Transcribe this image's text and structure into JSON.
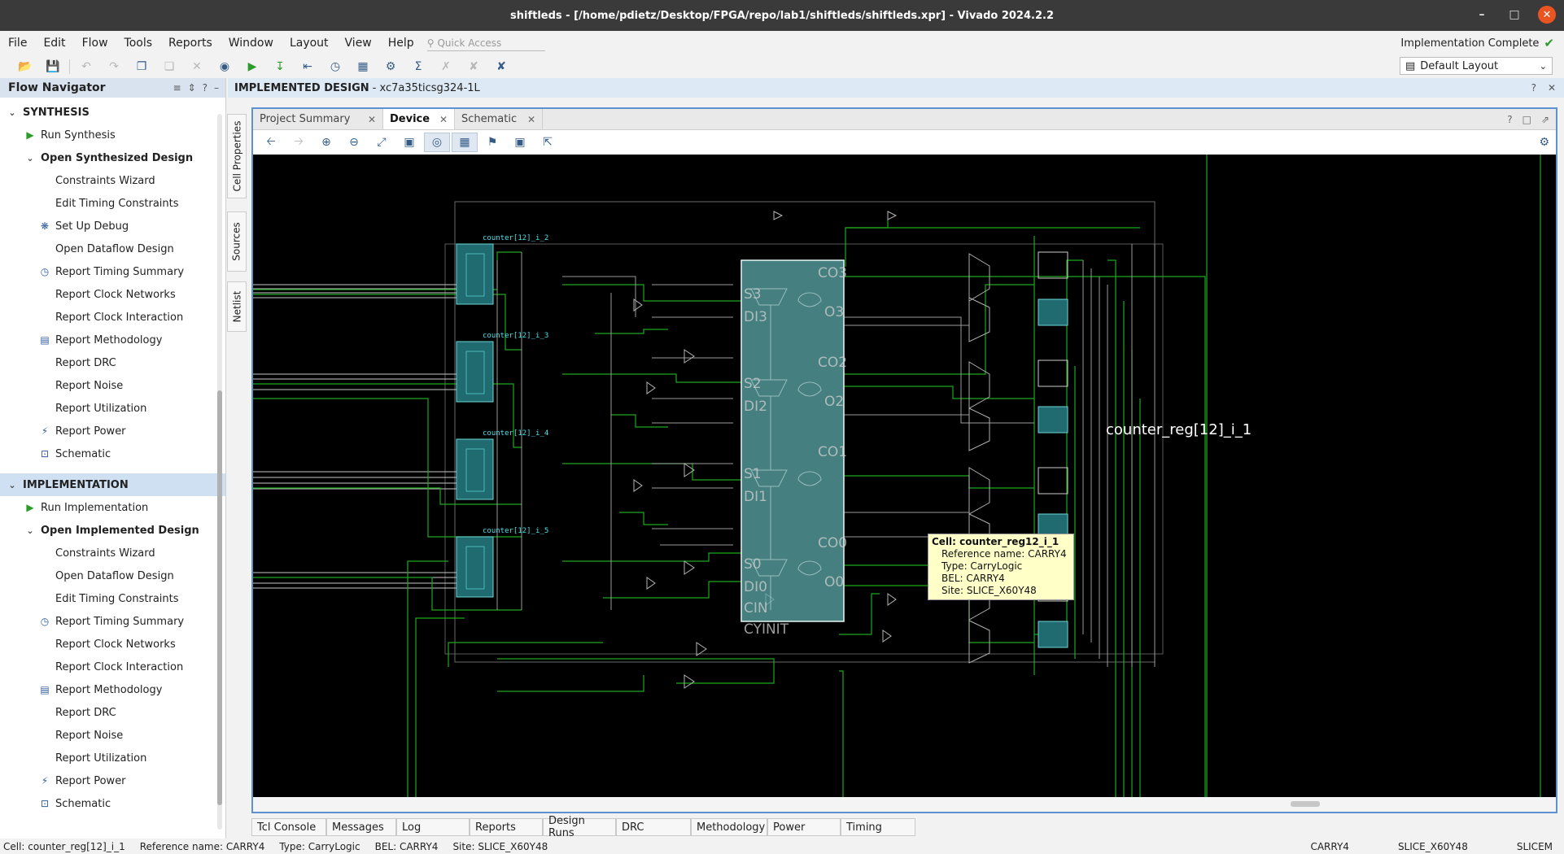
{
  "window": {
    "title": "shiftleds - [/home/pdietz/Desktop/FPGA/repo/lab1/shiftleds/shiftleds.xpr] - Vivado 2024.2.2"
  },
  "menu": [
    "File",
    "Edit",
    "Flow",
    "Tools",
    "Reports",
    "Window",
    "Layout",
    "View",
    "Help"
  ],
  "quick_access": {
    "placeholder": "Quick Access"
  },
  "status_top": {
    "label": "Implementation Complete"
  },
  "layout_select": {
    "value": "Default Layout"
  },
  "flow_navigator": {
    "title": "Flow Navigator",
    "synthesis": {
      "label": "SYNTHESIS",
      "run": "Run Synthesis",
      "open": "Open Synthesized Design",
      "items": [
        "Constraints Wizard",
        "Edit Timing Constraints",
        "Set Up Debug",
        "Open Dataflow Design",
        "Report Timing Summary",
        "Report Clock Networks",
        "Report Clock Interaction",
        "Report Methodology",
        "Report DRC",
        "Report Noise",
        "Report Utilization",
        "Report Power",
        "Schematic"
      ]
    },
    "implementation": {
      "label": "IMPLEMENTATION",
      "run": "Run Implementation",
      "open": "Open Implemented Design",
      "items": [
        "Constraints Wizard",
        "Open Dataflow Design",
        "Edit Timing Constraints",
        "Report Timing Summary",
        "Report Clock Networks",
        "Report Clock Interaction",
        "Report Methodology",
        "Report DRC",
        "Report Noise",
        "Report Utilization",
        "Report Power",
        "Schematic"
      ]
    }
  },
  "side_tabs": [
    "Cell Properties",
    "Sources",
    "Netlist"
  ],
  "implemented_header": {
    "title": "IMPLEMENTED DESIGN",
    "part": "- xc7a35ticsg324-1L"
  },
  "editor_tabs": [
    {
      "label": "Project Summary",
      "active": false
    },
    {
      "label": "Device",
      "active": true
    },
    {
      "label": "Schematic",
      "active": false
    }
  ],
  "device": {
    "cell_label": "counter_reg[12]_i_1",
    "sub_cells": [
      "counter[12]_i_2",
      "counter[12]_i_3",
      "counter[12]_i_4",
      "counter[12]_i_5"
    ],
    "pins_left": [
      "S3",
      "DI3",
      "S2",
      "DI2",
      "S1",
      "DI1",
      "S0",
      "DI0",
      "CIN",
      "CYINIT"
    ],
    "pins_right": [
      "CO3",
      "O3",
      "CO2",
      "O2",
      "CO1",
      "CO0",
      "O0"
    ],
    "colors": {
      "background": "#000000",
      "net": "#1fa81f",
      "cell_fill": "#5aa3a3",
      "slice_fill": "#1f6b70",
      "wire": "#c8c8c8"
    }
  },
  "tooltip": {
    "cell": "Cell: counter_reg12_i_1",
    "ref": "Reference name: CARRY4",
    "type": "Type: CarryLogic",
    "bel": "BEL: CARRY4",
    "site": "Site: SLICE_X60Y48"
  },
  "bottom_tabs": [
    "Tcl Console",
    "Messages",
    "Log",
    "Reports",
    "Design Runs",
    "DRC",
    "Methodology",
    "Power",
    "Timing"
  ],
  "statusbar": {
    "cell": "Cell: counter_reg[12]_i_1",
    "ref": "Reference name: CARRY4",
    "type": "Type: CarryLogic",
    "bel": "BEL: CARRY4",
    "site": "Site: SLICE_X60Y48",
    "r1": "CARRY4",
    "r2": "SLICE_X60Y48",
    "r3": "SLICEM"
  }
}
